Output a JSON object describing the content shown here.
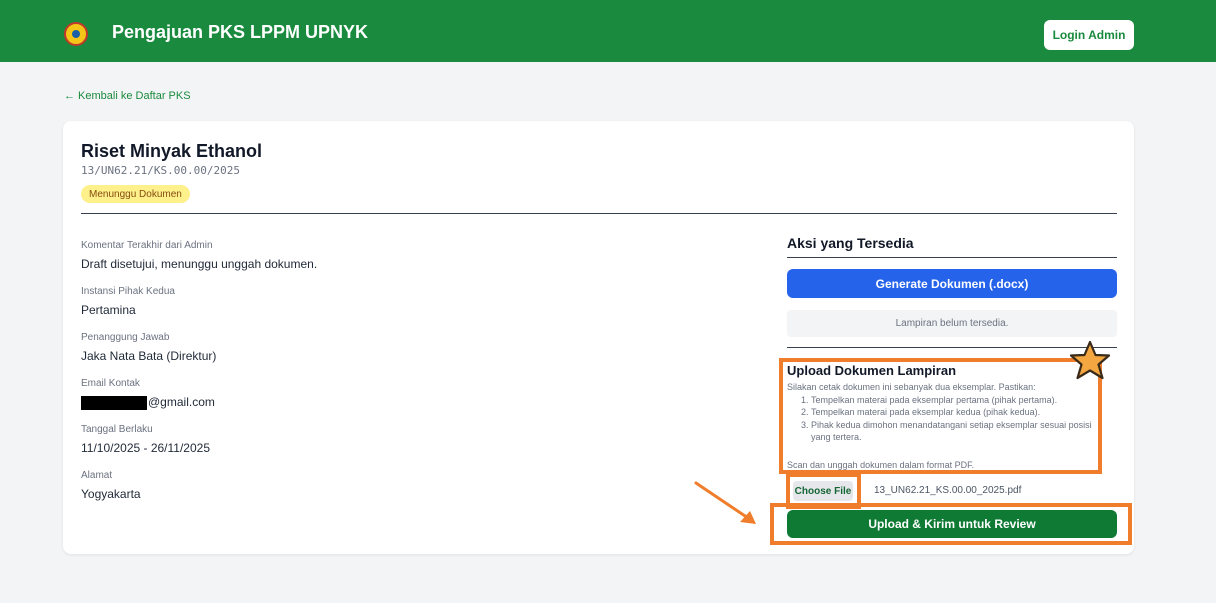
{
  "header": {
    "app_title": "Pengajuan PKS LPPM UPNYK",
    "login_label": "Login Admin"
  },
  "nav": {
    "back_label": "← Kembali ke Daftar PKS"
  },
  "project": {
    "title": "Riset Minyak Ethanol",
    "number": "13/UN62.21/KS.00.00/2025",
    "status": "Menunggu Dokumen"
  },
  "details": {
    "comment_label": "Komentar Terakhir dari Admin",
    "comment_value": "Draft disetujui, menunggu unggah dokumen.",
    "instansi_label": "Instansi Pihak Kedua",
    "instansi_value": "Pertamina",
    "pj_label": "Penanggung Jawab",
    "pj_value": "Jaka Nata Bata (Direktur)",
    "email_label": "Email Kontak",
    "email_value": "@gmail.com",
    "tanggal_label": "Tanggal Berlaku",
    "tanggal_value": "11/10/2025 - 26/11/2025",
    "alamat_label": "Alamat",
    "alamat_value": "Yogyakarta"
  },
  "actions": {
    "heading": "Aksi yang Tersedia",
    "generate_label": "Generate Dokumen (.docx)",
    "lampiran_status": "Lampiran belum tersedia."
  },
  "upload": {
    "heading": "Upload Dokumen Lampiran",
    "intro": "Silakan cetak dokumen ini sebanyak dua eksemplar. Pastikan:",
    "steps": [
      "Tempelkan materai pada eksemplar pertama (pihak pertama).",
      "Tempelkan materai pada eksemplar kedua (pihak kedua).",
      "Pihak kedua dimohon menandatangani setiap eksemplar sesuai posisi yang tertera."
    ],
    "scan_note": "Scan dan unggah dokumen dalam format PDF.",
    "choose_label": "Choose File",
    "file_name": "13_UN62.21_KS.00.00_2025.pdf",
    "submit_label": "Upload & Kirim untuk Review"
  },
  "colors": {
    "brand_green": "#1a8a3e",
    "primary_blue": "#2563eb",
    "annotation_orange": "#ef7d2b",
    "badge_yellow": "#fef08a"
  }
}
